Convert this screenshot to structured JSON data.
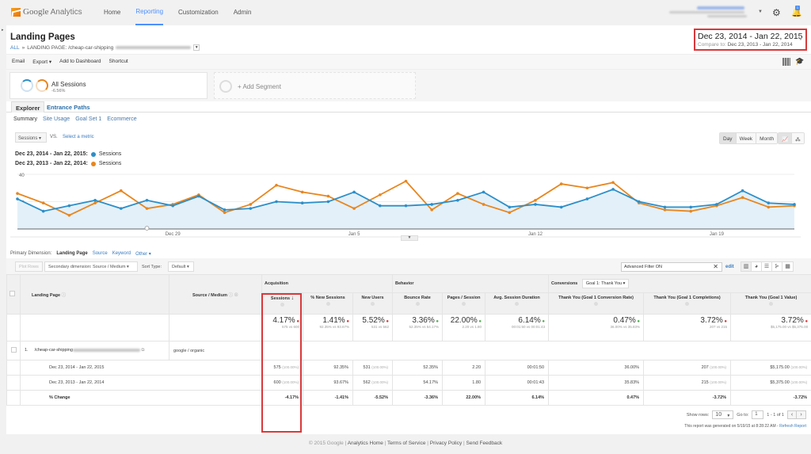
{
  "topbar": {
    "logo_text": "Google",
    "logo_product": "Analytics",
    "nav": [
      {
        "label": "Home",
        "active": false
      },
      {
        "label": "Reporting",
        "active": true
      },
      {
        "label": "Customization",
        "active": false
      },
      {
        "label": "Admin",
        "active": false
      }
    ],
    "notification_count": "1",
    "accent_color": "#4d90fe"
  },
  "page": {
    "title": "Landing Pages",
    "breadcrumb_all": "ALL",
    "breadcrumb_sep": "»",
    "breadcrumb_path": "LANDING PAGE: /cheap-car-shipping",
    "date_range": "Dec 23, 2014 - Jan 22, 2015",
    "compare_label": "Compare to:",
    "compare_range": "Dec 23, 2013 - Jan 22, 2014"
  },
  "actions": [
    "Email",
    "Export ▾",
    "Add to Dashboard",
    "Shortcut"
  ],
  "segments": {
    "active_name": "All Sessions",
    "active_change": "-6.56%",
    "add_label": "+ Add Segment"
  },
  "tabs": [
    {
      "label": "Explorer",
      "active": true
    },
    {
      "label": "Entrance Paths",
      "active": false
    }
  ],
  "subtabs": [
    {
      "label": "Summary",
      "active": true
    },
    {
      "label": "Site Usage",
      "active": false
    },
    {
      "label": "Goal Set 1",
      "active": false
    },
    {
      "label": "Ecommerce",
      "active": false
    }
  ],
  "chart_controls": {
    "metric": "Sessions ▾",
    "vs": "VS.",
    "select_metric": "Select a metric",
    "granularity": [
      "Day",
      "Week",
      "Month"
    ],
    "granularity_selected": "Day"
  },
  "legend": [
    {
      "range": "Dec 23, 2014 - Jan 22, 2015:",
      "metric": "Sessions",
      "color": "#2c8fc9"
    },
    {
      "range": "Dec 23, 2013 - Jan 22, 2014:",
      "metric": "Sessions",
      "color": "#e8861e"
    }
  ],
  "chart_data": {
    "type": "line",
    "title": "",
    "xlabel": "",
    "ylabel": "Sessions",
    "ylim": [
      0,
      40
    ],
    "yticks": [
      "40",
      "20"
    ],
    "xtick_labels": [
      {
        "label": "Dec 29",
        "index": 6
      },
      {
        "label": "Jan 5",
        "index": 13
      },
      {
        "label": "Jan 12",
        "index": 20
      },
      {
        "label": "Jan 19",
        "index": 27
      }
    ],
    "grid": true,
    "series": [
      {
        "name": "Sessions (Dec 23, 2014 - Jan 22, 2015)",
        "color": "#2c8fc9",
        "fill": true,
        "values": [
          22,
          13,
          17,
          21,
          15,
          21,
          17,
          24,
          14,
          15,
          20,
          19,
          20,
          27,
          17,
          17,
          18,
          21,
          27,
          16,
          18,
          16,
          22,
          29,
          20,
          16,
          16,
          18,
          28,
          19,
          18
        ]
      },
      {
        "name": "Sessions (Dec 23, 2013 - Jan 22, 2014)",
        "color": "#e8861e",
        "fill": false,
        "values": [
          26,
          19,
          10,
          19,
          28,
          15,
          18,
          25,
          12,
          18,
          32,
          27,
          24,
          15,
          25,
          35,
          14,
          26,
          18,
          12,
          21,
          33,
          30,
          34,
          19,
          14,
          13,
          17,
          23,
          16,
          17
        ]
      }
    ]
  },
  "primary_dimension": {
    "label": "Primary Dimension:",
    "current": "Landing Page",
    "options": [
      "Source",
      "Keyword",
      "Other ▾"
    ]
  },
  "table_controls": {
    "plot_rows": "Plot Rows",
    "secondary_dimension": "Secondary dimension: Source / Medium ▾",
    "sort_type_label": "Sort Type:",
    "sort_type": "Default ▾",
    "filter_value": "Advanced Filter ON",
    "edit_label": "edit"
  },
  "table": {
    "group_headers": {
      "acquisition": "Acquisition",
      "behavior": "Behavior",
      "conversions": "Conversions",
      "goal_select": "Goal 1: Thank You ▾"
    },
    "columns": [
      "Landing Page",
      "Source / Medium",
      "Sessions",
      "% New Sessions",
      "New Users",
      "Bounce Rate",
      "Pages / Session",
      "Avg. Session Duration",
      "Thank You (Goal 1 Conversion Rate)",
      "Thank You (Goal 1 Completions)",
      "Thank You (Goal 1 Value)"
    ],
    "sort_indicator": "↓",
    "totals": [
      {
        "value": "4.17%",
        "trend": "down",
        "detail": "575 vs 600"
      },
      {
        "value": "1.41%",
        "trend": "down",
        "detail": "92.35% vs 93.67%"
      },
      {
        "value": "5.52%",
        "trend": "down",
        "detail": "531 vs 562"
      },
      {
        "value": "3.36%",
        "trend": "up",
        "detail": "52.35% vs 54.17%"
      },
      {
        "value": "22.00%",
        "trend": "up",
        "detail": "2.20 vs 1.80"
      },
      {
        "value": "6.14%",
        "trend": "up",
        "detail": "00:01:50 vs 00:01:43"
      },
      {
        "value": "0.47%",
        "trend": "up",
        "detail": "36.00% vs 35.83%"
      },
      {
        "value": "3.72%",
        "trend": "down",
        "detail": "207 vs 215"
      },
      {
        "value": "3.72%",
        "trend": "down",
        "detail": "$5,175.00 vs $5,375.00"
      }
    ],
    "row": {
      "index": "1.",
      "landing_page": "/cheap-car-shipping",
      "source_medium": "google / organic"
    },
    "subrows": [
      {
        "label": "Dec 23, 2014 - Jan 22, 2015",
        "cells": [
          {
            "v": "575",
            "p": "(100.00%)"
          },
          {
            "v": "92.35%",
            "p": ""
          },
          {
            "v": "531",
            "p": "(100.00%)"
          },
          {
            "v": "52.35%",
            "p": ""
          },
          {
            "v": "2.20",
            "p": ""
          },
          {
            "v": "00:01:50",
            "p": ""
          },
          {
            "v": "36.00%",
            "p": ""
          },
          {
            "v": "207",
            "p": "(100.00%)"
          },
          {
            "v": "$5,175.00",
            "p": "(100.00%)"
          }
        ]
      },
      {
        "label": "Dec 23, 2013 - Jan 22, 2014",
        "cells": [
          {
            "v": "600",
            "p": "(100.00%)"
          },
          {
            "v": "93.67%",
            "p": ""
          },
          {
            "v": "562",
            "p": "(100.00%)"
          },
          {
            "v": "54.17%",
            "p": ""
          },
          {
            "v": "1.80",
            "p": ""
          },
          {
            "v": "00:01:43",
            "p": ""
          },
          {
            "v": "35.83%",
            "p": ""
          },
          {
            "v": "215",
            "p": "(100.00%)"
          },
          {
            "v": "$5,375.00",
            "p": "(100.00%)"
          }
        ]
      },
      {
        "label": "% Change",
        "bold": true,
        "cells": [
          {
            "v": "-4.17%",
            "p": ""
          },
          {
            "v": "-1.41%",
            "p": ""
          },
          {
            "v": "-5.52%",
            "p": ""
          },
          {
            "v": "-3.36%",
            "p": ""
          },
          {
            "v": "22.00%",
            "p": ""
          },
          {
            "v": "6.14%",
            "p": ""
          },
          {
            "v": "0.47%",
            "p": ""
          },
          {
            "v": "-3.72%",
            "p": ""
          },
          {
            "v": "-3.72%",
            "p": ""
          }
        ]
      }
    ],
    "status_colors": {
      "down": "#e03535",
      "up": "#4cae4c"
    }
  },
  "pagination": {
    "show_rows_label": "Show rows:",
    "show_rows": "10",
    "goto_label": "Go to:",
    "goto_value": "1",
    "range": "1 - 1 of 1"
  },
  "report_note": "This report was generated on 5/19/15 at 8:28:22 AM - ",
  "refresh_label": "Refresh Report",
  "footer": {
    "copyright": "© 2015 Google",
    "links": [
      "Analytics Home",
      "Terms of Service",
      "Privacy Policy",
      "Send Feedback"
    ]
  }
}
